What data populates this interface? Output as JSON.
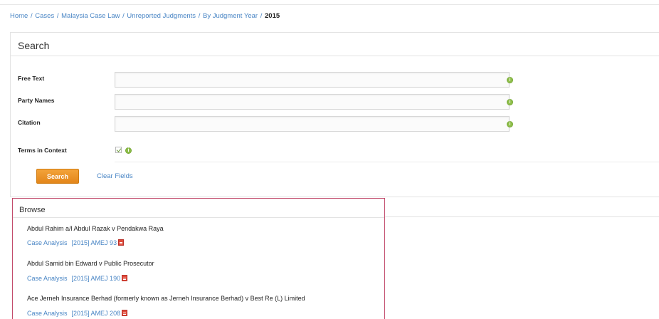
{
  "breadcrumb": {
    "items": [
      "Home",
      "Cases",
      "Malaysia Case Law",
      "Unreported Judgments",
      "By Judgment Year"
    ],
    "separator": "/",
    "current": "2015"
  },
  "search": {
    "title": "Search",
    "fields": [
      {
        "label": "Free Text",
        "value": "",
        "info_icon": "info-icon"
      },
      {
        "label": "Party Names",
        "value": "",
        "info_icon": "info-icon"
      },
      {
        "label": "Citation",
        "value": "",
        "info_icon": "info-icon"
      }
    ],
    "terms_in_context": {
      "label": "Terms in Context",
      "checked": true,
      "info_icon": "info-icon"
    },
    "search_button": "Search",
    "clear_link": "Clear Fields",
    "accent": "#e8901f"
  },
  "browse": {
    "title": "Browse",
    "border_color": "#c24b6c",
    "results": [
      {
        "title": "Abdul Rahim a/l Abdul Razak v Pendakwa Raya",
        "analysis": "Case Analysis",
        "citation": "[2015] AMEJ 93",
        "icon": "pdf-icon"
      },
      {
        "title": "Abdul Samid bin Edward v Public Prosecutor",
        "analysis": "Case Analysis",
        "citation": "[2015] AMEJ 190",
        "icon": "pdf-icon"
      },
      {
        "title": "Ace Jerneh Insurance Berhad (formerly known as Jerneh Insurance Berhad) v Best Re (L) Limited",
        "analysis": "Case Analysis",
        "citation": "[2015] AMEJ 208",
        "icon": "pdf-icon"
      }
    ]
  },
  "colors": {
    "link": "#4a86c5",
    "info_icon": "#8fbf4a"
  }
}
